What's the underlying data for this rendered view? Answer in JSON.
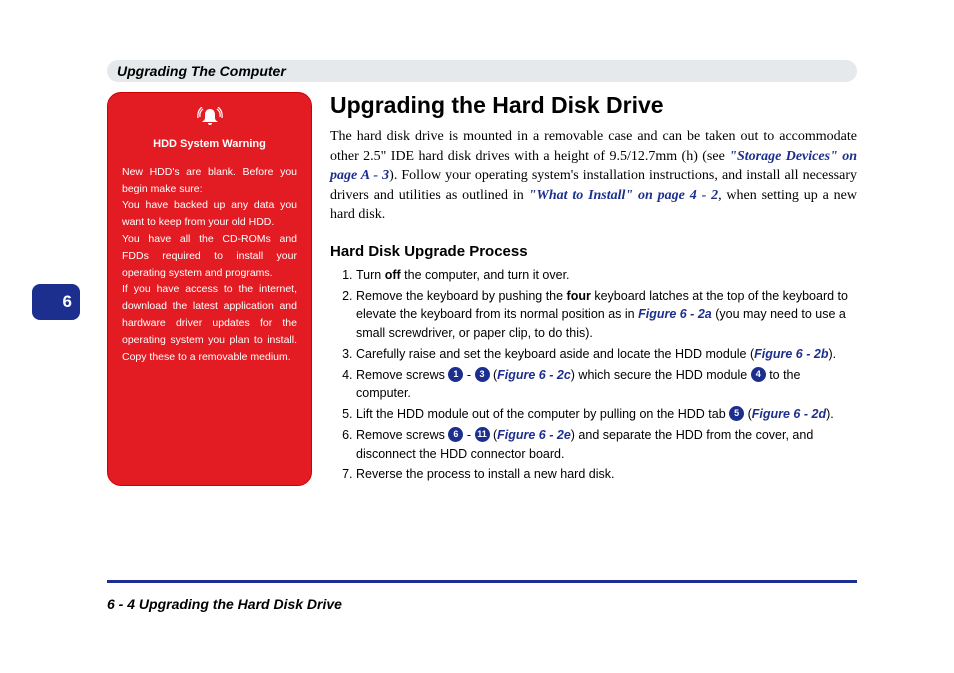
{
  "tab": {
    "number": "6"
  },
  "header": {
    "title": "Upgrading The Computer"
  },
  "warning": {
    "title": "HDD System Warning",
    "body": "New HDD's are blank. Before you begin make sure:\nYou have backed up any data you want to keep from your old HDD.\nYou have all the CD-ROMs and FDDs required to install your operating system and programs.\nIf you have access to the internet, download the latest application and hardware driver updates for the operating system you plan to install. Copy these to a removable medium."
  },
  "main": {
    "title": "Upgrading the Hard Disk Drive",
    "intro_pre": "The hard disk drive is mounted in a removable case and can be taken out to accommodate other 2.5\" IDE hard disk drives with a height of 9.5/12.7mm (h) (see ",
    "intro_link1": "\"Storage Devices\" on page  A - 3",
    "intro_mid": "). Follow your operating system's installation instructions, and install all necessary drivers and utilities as outlined in ",
    "intro_link2": "\"What to Install\" on page 4 - 2",
    "intro_post": ", when setting up a new hard disk.",
    "subheading": "Hard Disk Upgrade Process",
    "steps": {
      "s1_a": "Turn ",
      "s1_b": "off",
      "s1_c": " the computer, and turn it over.",
      "s2_a": "Remove the keyboard by pushing the ",
      "s2_b": "four",
      "s2_c": " keyboard latches at the top of the keyboard to elevate the keyboard from its normal position as in ",
      "s2_fig": "Figure 6 - 2a",
      "s2_d": " (you may need to use a small screwdriver, or paper clip, to do this).",
      "s3_a": "Carefully raise and set the keyboard aside and locate the HDD module (",
      "s3_fig": "Figure 6 - 2b",
      "s3_b": ").",
      "s4_a": "Remove screws ",
      "s4_n1": "1",
      "s4_dash": " - ",
      "s4_n2": "3",
      "s4_b": " (",
      "s4_fig": "Figure 6 - 2c",
      "s4_c": ") which secure the HDD module ",
      "s4_n3": "4",
      "s4_d": " to the computer.",
      "s5_a": "Lift the HDD module out of the computer by pulling on the HDD tab ",
      "s5_n1": "5",
      "s5_b": " (",
      "s5_fig": "Figure 6 - 2d",
      "s5_c": ").",
      "s6_a": "Remove screws ",
      "s6_n1": "6",
      "s6_dash": " - ",
      "s6_n2": "11",
      "s6_b": " (",
      "s6_fig": "Figure 6 - 2e",
      "s6_c": ") and separate the HDD from the cover, and disconnect the HDD connector board.",
      "s7": "Reverse the process to install a new hard disk."
    }
  },
  "footer": {
    "text": "6  -  4  Upgrading the Hard Disk Drive"
  }
}
